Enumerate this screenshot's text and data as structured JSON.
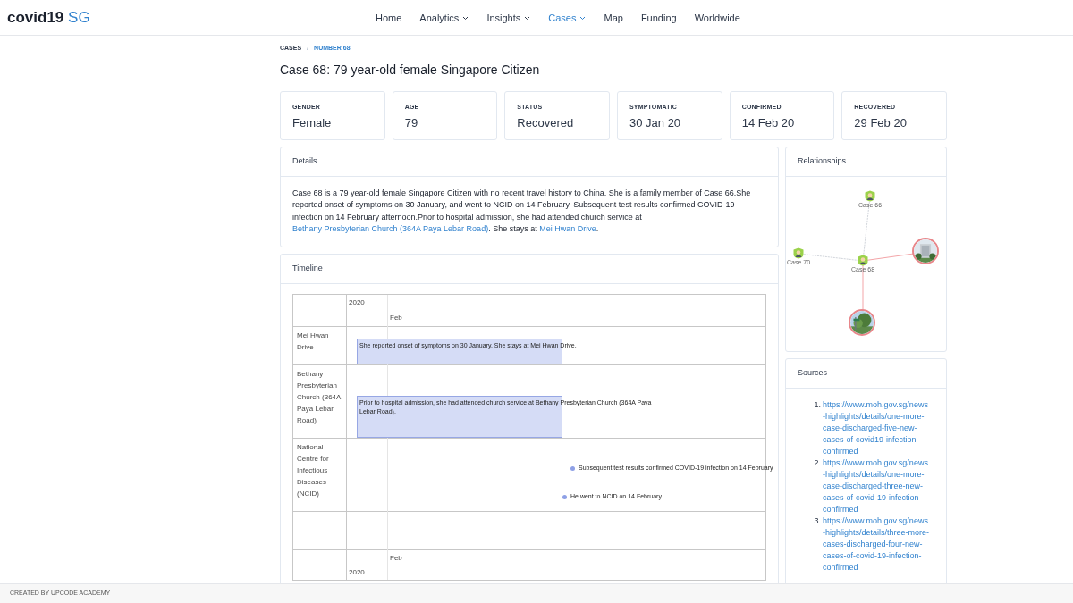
{
  "header": {
    "logo": {
      "main": "covid19",
      "accent": "SG"
    },
    "nav": [
      {
        "label": "Home",
        "dropdown": false,
        "selected": false
      },
      {
        "label": "Analytics",
        "dropdown": true,
        "selected": false
      },
      {
        "label": "Insights",
        "dropdown": true,
        "selected": false
      },
      {
        "label": "Cases",
        "dropdown": true,
        "selected": true
      },
      {
        "label": "Map",
        "dropdown": false,
        "selected": false
      },
      {
        "label": "Funding",
        "dropdown": false,
        "selected": false
      },
      {
        "label": "Worldwide",
        "dropdown": false,
        "selected": false
      }
    ]
  },
  "breadcrumb": [
    {
      "label": "CASES",
      "selected": false
    },
    {
      "label": "NUMBER 68",
      "selected": true
    }
  ],
  "breadcrumb_separator": "/",
  "title": "Case 68: 79 year-old female Singapore Citizen",
  "stats": [
    {
      "label": "GENDER",
      "value": "Female"
    },
    {
      "label": "AGE",
      "value": "79"
    },
    {
      "label": "STATUS",
      "value": "Recovered"
    },
    {
      "label": "SYMPTOMATIC",
      "value": "30 Jan 20"
    },
    {
      "label": "CONFIRMED",
      "value": "14 Feb 20"
    },
    {
      "label": "RECOVERED",
      "value": "29 Feb 20"
    }
  ],
  "details": {
    "title": "Details",
    "parts": [
      {
        "kind": "text",
        "text": "Case 68 is a 79 year-old female Singapore Citizen with no recent travel history to China. She is a family member of Case 66.She reported onset of symptoms on 30 January, and went to NCID on 14 February. Subsequent test results confirmed COVID-19 infection on 14 February afternoon.Prior to hospital admission, she had attended church service at "
      },
      {
        "kind": "link",
        "text": "Bethany Presbyterian Church (364A Paya Lebar Road)"
      },
      {
        "kind": "text",
        "text": ". She stays at "
      },
      {
        "kind": "link",
        "text": "Mei Hwan Drive"
      },
      {
        "kind": "text",
        "text": "."
      }
    ]
  },
  "timeline": {
    "title": "Timeline",
    "year": "2020",
    "month": "Feb",
    "footer_month": "Feb",
    "footer_year": "2020",
    "lanes": [
      {
        "label": "Mei Hwan Drive",
        "items": [
          {
            "kind": "range",
            "text": "She reported onset of symptoms on 30 January. She stays at Mei Hwan Drive."
          }
        ]
      },
      {
        "label": "Bethany Presbyterian Church (364A Paya Lebar Road)",
        "items": [
          {
            "kind": "range",
            "text": "Prior to hospital admission, she had attended church service at Bethany Presbyterian Church (364A Paya Lebar Road)."
          }
        ]
      },
      {
        "label": "National Centre for Infectious Diseases (NCID)",
        "items": [
          {
            "kind": "point",
            "text": "Subsequent test results confirmed COVID-19 infection on 14 February"
          },
          {
            "kind": "point",
            "text": "He went to NCID on 14 February."
          }
        ]
      }
    ]
  },
  "relationships": {
    "title": "Relationships",
    "nodes": [
      {
        "kind": "person",
        "label": "Case 66"
      },
      {
        "kind": "person",
        "label": "Case 70"
      },
      {
        "kind": "person",
        "label": "Case 68"
      },
      {
        "kind": "picture"
      },
      {
        "kind": "picture"
      }
    ]
  },
  "sources": {
    "title": "Sources",
    "items": [
      {
        "number": "1.",
        "url": "https://www.moh.gov.sg/news-highlights/details/one-more-case-discharged-five-new-cases-of-covid19-infection-confirmed"
      },
      {
        "number": "2.",
        "url": "https://www.moh.gov.sg/news-highlights/details/one-more-case-discharged-three-new-cases-of-covid-19-infection-confirmed"
      },
      {
        "number": "3.",
        "url": "https://www.moh.gov.sg/news-highlights/details/three-more-cases-discharged-four-new-cases-of-covid-19-infection-confirmed"
      }
    ]
  },
  "footer": "CREATED BY UPCODE ACADEMY"
}
